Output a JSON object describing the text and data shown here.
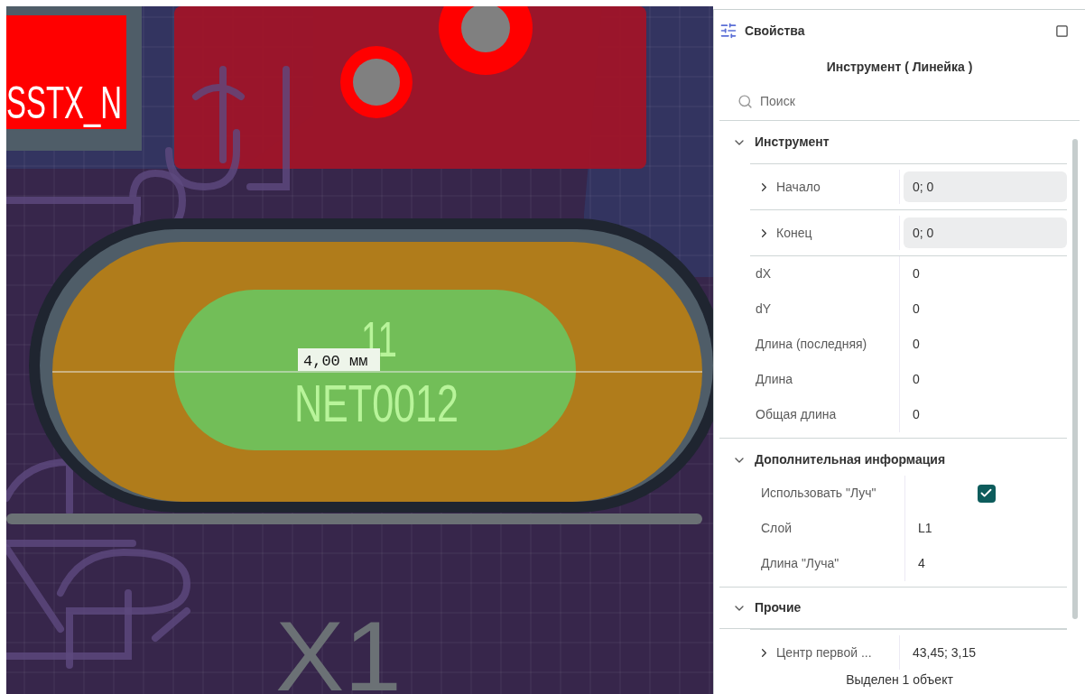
{
  "canvas": {
    "pad_label": "SSTX_N",
    "pin_number": "11",
    "net_name": "NET0012",
    "measurement": "4,00 мм",
    "designator": "X1"
  },
  "panel": {
    "title": "Свойства",
    "subtitle": "Инструмент ( Линейка )",
    "search": {
      "placeholder": "Поиск"
    },
    "sections": [
      {
        "title": "Инструмент",
        "expanded": true,
        "rows": [
          {
            "kind": "group",
            "label": "Начало",
            "value": "0; 0",
            "editable": true,
            "expanded": false
          },
          {
            "kind": "group",
            "label": "Конец",
            "value": "0; 0",
            "editable": true,
            "expanded": false
          },
          {
            "kind": "text",
            "label": "dX",
            "value": "0"
          },
          {
            "kind": "text",
            "label": "dY",
            "value": "0"
          },
          {
            "kind": "text",
            "label": "Длина (последняя)",
            "value": "0"
          },
          {
            "kind": "text",
            "label": "Длина",
            "value": "0"
          },
          {
            "kind": "text",
            "label": "Общая длина",
            "value": "0"
          }
        ]
      },
      {
        "title": "Дополнительная информация",
        "expanded": true,
        "rows": [
          {
            "kind": "checkbox",
            "label": "Использовать \"Луч\"",
            "checked": true
          },
          {
            "kind": "text",
            "label": "Слой",
            "value": "L1"
          },
          {
            "kind": "text",
            "label": "Длина \"Луча\"",
            "value": "4"
          }
        ]
      },
      {
        "title": "Прочие",
        "expanded": true,
        "rows": [
          {
            "kind": "group",
            "label": "Центр первой ...",
            "value": "43,45; 3,15",
            "editable": false,
            "expanded": false
          }
        ]
      }
    ],
    "status": "Выделен 1 объект"
  }
}
